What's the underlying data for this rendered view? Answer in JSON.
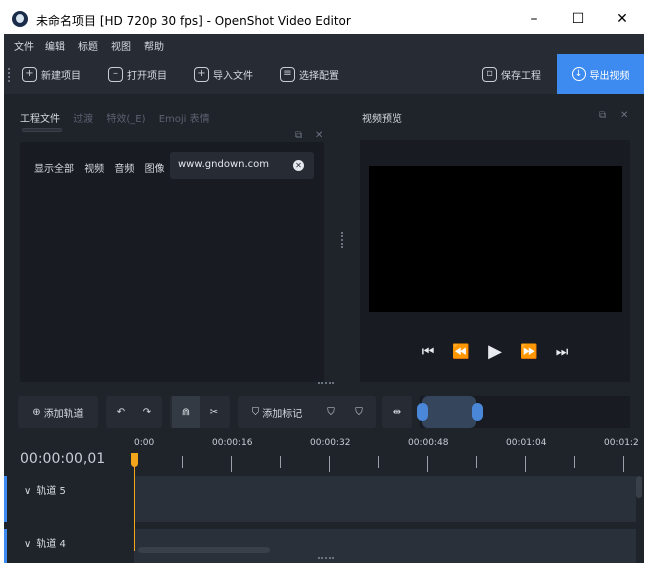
{
  "window": {
    "title": "未命名项目 [HD 720p 30 fps] - OpenShot Video Editor",
    "controls": {
      "minimize": "–",
      "maximize": "☐",
      "close": "✕"
    }
  },
  "menu": [
    "文件",
    "编辑",
    "标题",
    "视图",
    "帮助"
  ],
  "toolbar": {
    "new_project": "新建项目",
    "open_project": "打开项目",
    "import_files": "导入文件",
    "choose_profile": "选择配置",
    "save_project": "保存工程",
    "export_video": "导出视频"
  },
  "left_panel": {
    "tabs": [
      "工程文件",
      "过渡",
      "特效(_E)",
      "Emoji 表情"
    ],
    "active_tab": 0,
    "filters": [
      "显示全部",
      "视频",
      "音频",
      "图像"
    ],
    "search": {
      "value": "www.gndown.com"
    }
  },
  "right_panel": {
    "title": "视频预览"
  },
  "timeline_toolbar": {
    "add_track": "添加轨道",
    "add_marker": "添加标记"
  },
  "timeline": {
    "timecode": "00:00:00,01",
    "ruler_labels": [
      "0:00",
      "00:00:16",
      "00:00:32",
      "00:00:48",
      "00:01:04",
      "00:01:2"
    ],
    "tracks": [
      {
        "name": "轨道 5"
      },
      {
        "name": "轨道 4"
      }
    ]
  },
  "colors": {
    "accent": "#3d8bf0",
    "playhead": "#f3a51c",
    "background": "#1f232a"
  }
}
